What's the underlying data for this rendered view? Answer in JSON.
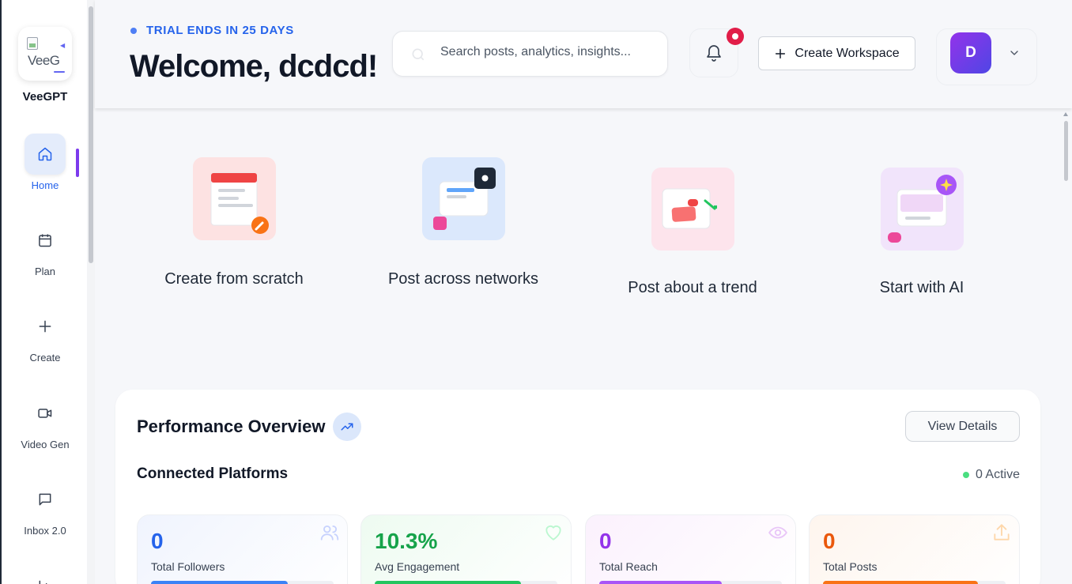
{
  "sidebar": {
    "logo_alt": "VeeG",
    "brand": "VeeGPT",
    "items": [
      {
        "label": "Home",
        "icon": "home-icon",
        "active": true
      },
      {
        "label": "Plan",
        "icon": "calendar-icon"
      },
      {
        "label": "Create",
        "icon": "plus-icon"
      },
      {
        "label": "Video Gen",
        "icon": "video-icon"
      },
      {
        "label": "Inbox 2.0",
        "icon": "chat-icon"
      }
    ]
  },
  "header": {
    "trial": "TRIAL ENDS IN 25 DAYS",
    "welcome": "Welcome, dcdcd!",
    "search_placeholder": "Search posts, analytics, insights...",
    "create_workspace": "Create Workspace",
    "avatar_initial": "D"
  },
  "quick_actions": [
    {
      "label": "Create from scratch",
      "icon": "document-edit-icon"
    },
    {
      "label": "Post across networks",
      "icon": "cross-post-icon"
    },
    {
      "label": "Post about a trend",
      "icon": "trend-post-icon"
    },
    {
      "label": "Start with AI",
      "icon": "ai-sparkle-icon"
    }
  ],
  "performance": {
    "title": "Performance Overview",
    "view_details": "View Details",
    "connected_title": "Connected Platforms",
    "active_count": "0 Active",
    "stats": [
      {
        "value": "0",
        "label": "Total Followers",
        "color": "#2563eb",
        "bar_color": "#3b82f6",
        "bg": "#f0f4fe",
        "progress": 0.75,
        "icon": "users-icon"
      },
      {
        "value": "10.3%",
        "label": "Avg Engagement",
        "color": "#16a34a",
        "bar_color": "#22c55e",
        "bg": "#eefbf1",
        "progress": 0.8,
        "icon": "heart-icon"
      },
      {
        "value": "0",
        "label": "Total Reach",
        "color": "#9333ea",
        "bar_color": "#a855f7",
        "bg": "#fbf1fd",
        "progress": 0.67,
        "icon": "eye-icon"
      },
      {
        "value": "0",
        "label": "Total Posts",
        "color": "#ea580c",
        "bar_color": "#f97316",
        "bg": "#fef5ee",
        "progress": 0.85,
        "icon": "share-icon"
      }
    ]
  }
}
